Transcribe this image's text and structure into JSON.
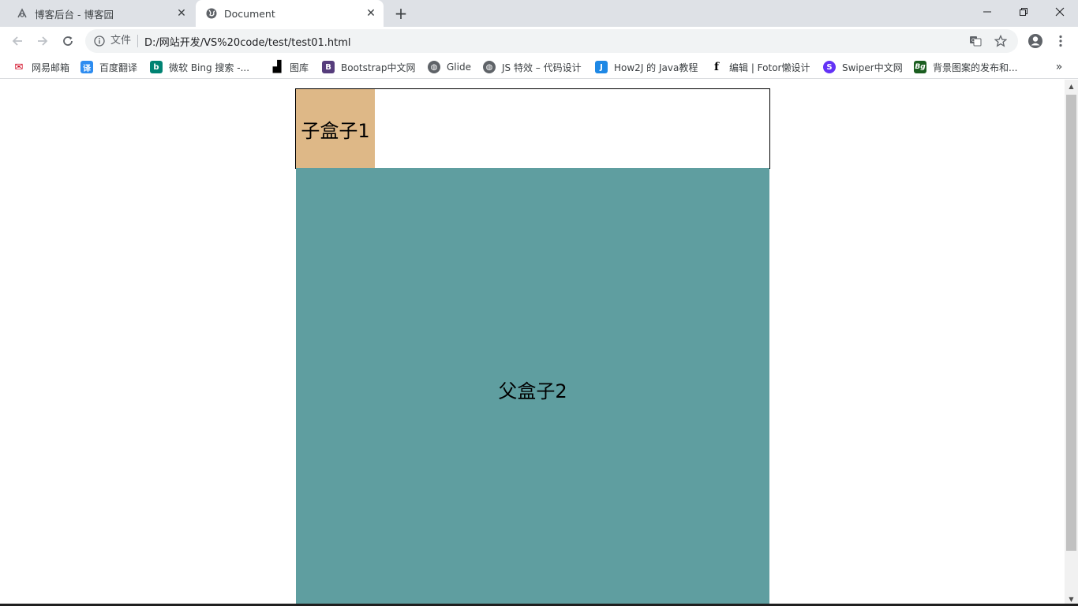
{
  "tabs": [
    {
      "title": "博客后台 - 博客园",
      "icon": "cnblogs-icon"
    },
    {
      "title": "Document",
      "icon": "globe-icon"
    }
  ],
  "toolbar": {
    "scheme_label": "文件",
    "url": "D:/网站开发/VS%20code/test/test01.html"
  },
  "bookmarks": [
    {
      "label": "网易邮箱",
      "icon_color": "#d0021b",
      "icon_text": "✉"
    },
    {
      "label": "百度翻译",
      "icon_color": "#2d8cf0",
      "icon_text": "译"
    },
    {
      "label": "微软 Bing 搜索 -...",
      "icon_color": "#008373",
      "icon_text": "b"
    },
    {
      "label": "图库",
      "icon_color": "#000000",
      "icon_text": "▟"
    },
    {
      "label": "Bootstrap中文网",
      "icon_color": "#563d7c",
      "icon_text": "B"
    },
    {
      "label": "Glide",
      "icon_color": "#5f6368",
      "icon_text": "◍"
    },
    {
      "label": "JS 特效 – 代码设计",
      "icon_color": "#5f6368",
      "icon_text": "◍"
    },
    {
      "label": "How2J 的 Java教程",
      "icon_color": "#1e88e5",
      "icon_text": "J"
    },
    {
      "label": "编辑 | Fotor懒设计",
      "icon_color": "#000000",
      "icon_text": "f"
    },
    {
      "label": "Swiper中文网",
      "icon_color": "#6332f6",
      "icon_text": "S"
    },
    {
      "label": "背景图案的发布和...",
      "icon_color": "#1b5e20",
      "icon_text": "Bg"
    }
  ],
  "content": {
    "child_box_label": "子盒子1",
    "parent_box_label": "父盒子2"
  },
  "colors": {
    "child_box": "#deb887",
    "parent_box": "#5f9ea0"
  }
}
